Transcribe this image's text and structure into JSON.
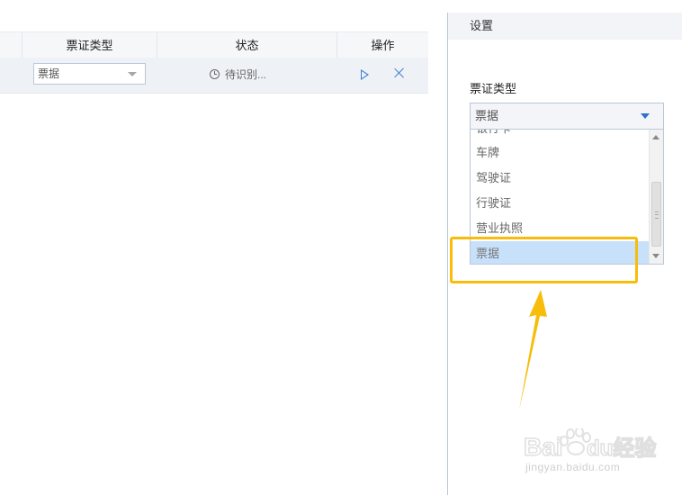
{
  "table": {
    "columns": [
      "票证类型",
      "状态",
      "操作"
    ],
    "rows": [
      {
        "ticket_type": "票据",
        "status": "待识别..."
      }
    ]
  },
  "settings": {
    "title": "设置",
    "field_label": "票证类型",
    "selected_value": "票据",
    "options": [
      "银行卡",
      "车牌",
      "驾驶证",
      "行驶证",
      "营业执照",
      "票据"
    ],
    "selected_option": "票据"
  },
  "colors": {
    "accent": "#3d7fd6",
    "highlight": "#f7bd0a",
    "selected_option_bg": "#c8e1fb"
  },
  "watermark": {
    "brand": "Baidu经验",
    "url": "jingyan.baidu.com"
  }
}
